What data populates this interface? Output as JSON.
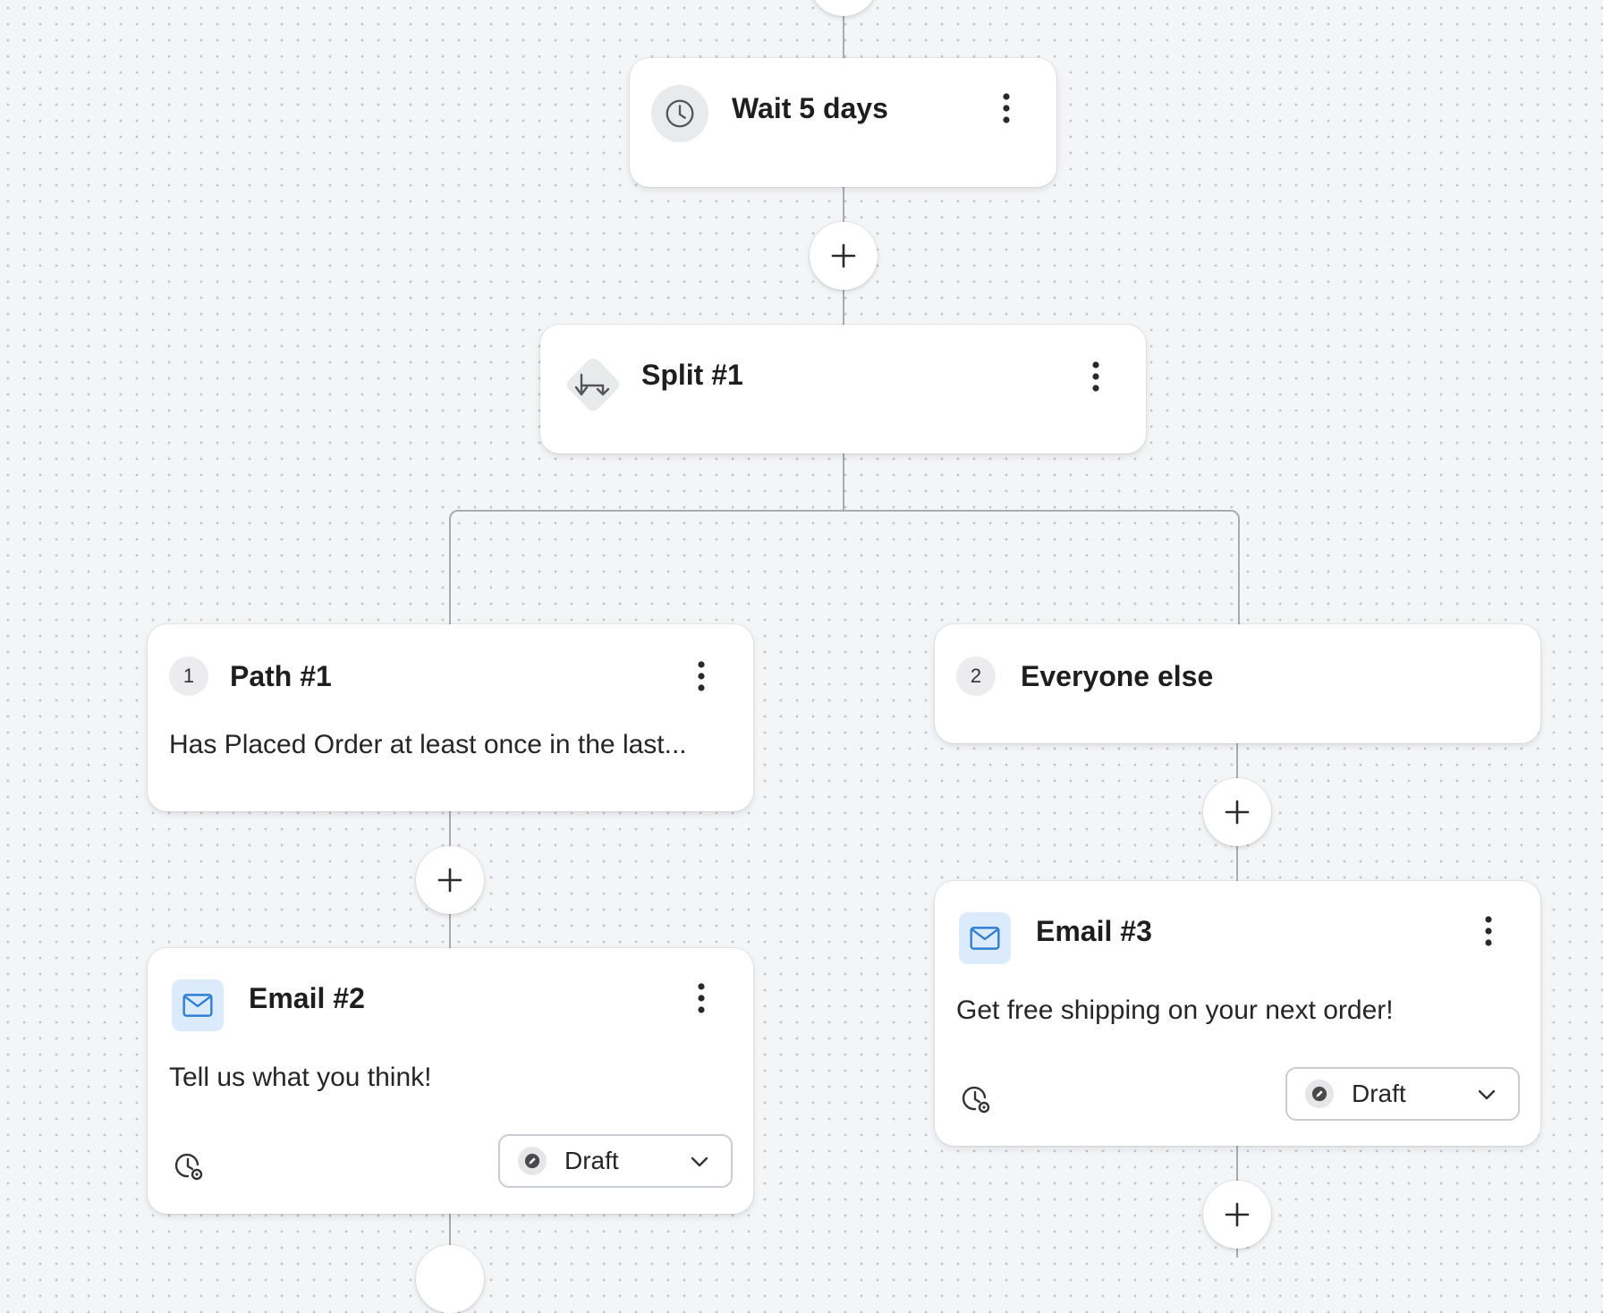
{
  "nodes": {
    "wait": {
      "title": "Wait 5 days",
      "icon": "clock-icon"
    },
    "split": {
      "title": "Split #1",
      "icon": "split-icon"
    },
    "path1": {
      "number": "1",
      "title": "Path #1",
      "description": "Has Placed Order at least once in the last..."
    },
    "path2": {
      "number": "2",
      "title": "Everyone else"
    },
    "email2": {
      "title": "Email #2",
      "description": "Tell us what you think!",
      "status": "Draft",
      "icon": "mail-icon"
    },
    "email3": {
      "title": "Email #3",
      "description": "Get free shipping on your next order!",
      "status": "Draft",
      "icon": "mail-icon"
    }
  },
  "colors": {
    "canvas_bg": "#f4f5f7",
    "connector": "#a8abb0",
    "mail_icon": "#2f7fd4",
    "mail_icon_bg": "#dcebfb"
  }
}
